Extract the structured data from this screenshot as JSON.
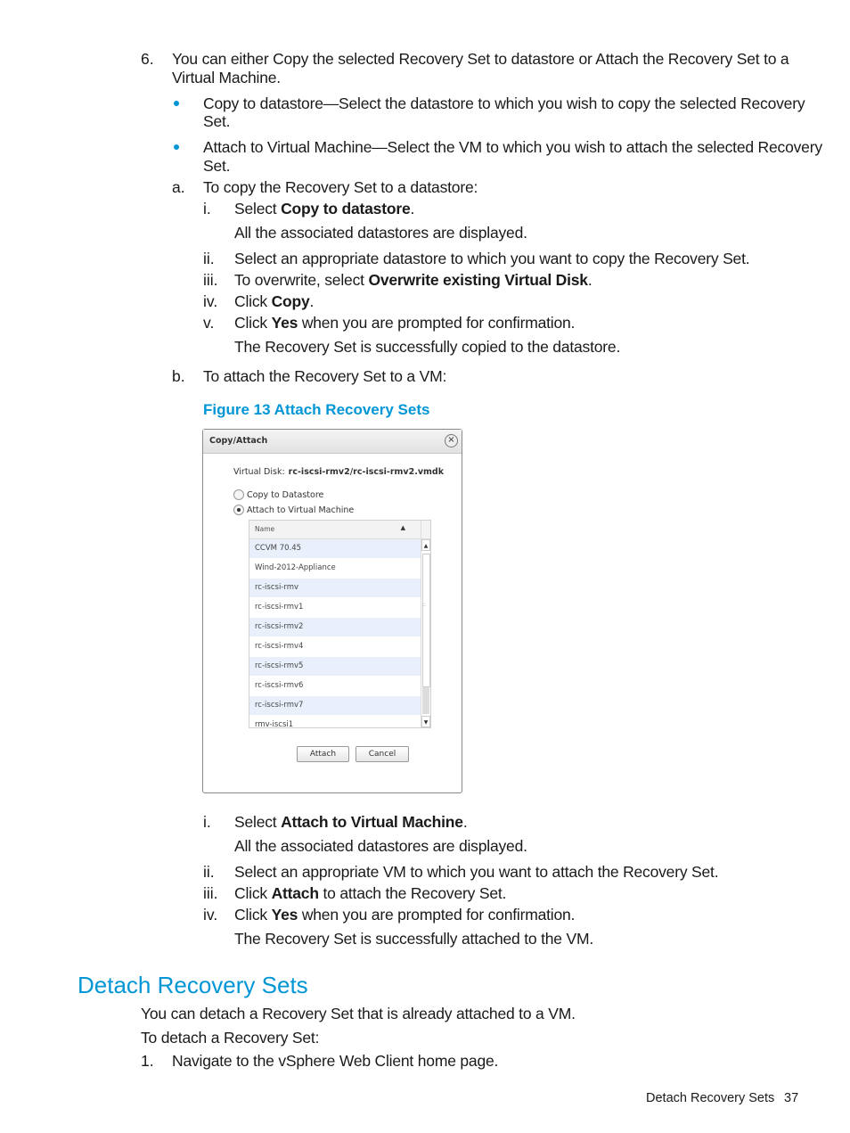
{
  "step6": {
    "number": "6.",
    "line1": "You can either Copy the selected Recovery Set to datastore or Attach the Recovery Set to a",
    "line2": "Virtual Machine.",
    "bullets": [
      {
        "line1": "Copy to datastore—Select the datastore to which you wish to copy the selected Recovery",
        "line2": "Set."
      },
      {
        "line1": "Attach to Virtual Machine—Select the VM to which you wish to attach the selected Recovery",
        "line2": "Set."
      }
    ]
  },
  "sub_a": {
    "label": "a.",
    "text": "To copy the Recovery Set to a datastore:",
    "steps": [
      {
        "num": "i.",
        "pre": "Select ",
        "bold": "Copy to datastore",
        "post": ".",
        "note": "All the associated datastores are displayed."
      },
      {
        "num": "ii.",
        "pre": "Select an appropriate datastore to which you want to copy the Recovery Set.",
        "bold": "",
        "post": ""
      },
      {
        "num": "iii.",
        "pre": "To overwrite, select ",
        "bold": "Overwrite existing Virtual Disk",
        "post": "."
      },
      {
        "num": "iv.",
        "pre": "Click ",
        "bold": "Copy",
        "post": "."
      },
      {
        "num": "v.",
        "pre": "Click ",
        "bold": "Yes",
        "post": " when you are prompted for confirmation.",
        "note": "The Recovery Set is successfully copied to the datastore."
      }
    ]
  },
  "sub_b": {
    "label": "b.",
    "text": "To attach the Recovery Set to a VM:",
    "steps": [
      {
        "num": "i.",
        "pre": "Select ",
        "bold": "Attach to Virtual Machine",
        "post": ".",
        "note": "All the associated datastores are displayed."
      },
      {
        "num": "ii.",
        "pre": "Select an appropriate VM to which you want to attach the Recovery Set.",
        "bold": "",
        "post": ""
      },
      {
        "num": "iii.",
        "pre": "Click ",
        "bold": "Attach",
        "post": " to attach the Recovery Set."
      },
      {
        "num": "iv.",
        "pre": "Click ",
        "bold": "Yes",
        "post": " when you are prompted for confirmation.",
        "note": "The Recovery Set is successfully attached to the VM."
      }
    ]
  },
  "figure": {
    "caption": "Figure 13 Attach Recovery Sets",
    "dialog": {
      "title": "Copy/Attach",
      "close_icon": "×",
      "virtual_disk_label": "Virtual Disk:",
      "virtual_disk_value": "rc-iscsi-rmv2/rc-iscsi-rmv2.vmdk",
      "options": [
        {
          "label": "Copy to Datastore",
          "selected": false
        },
        {
          "label": "Attach to Virtual Machine",
          "selected": true
        }
      ],
      "grid": {
        "column": "Name",
        "sort_icon": "▲",
        "rows": [
          "CCVM 70.45",
          "Wind-2012-Appliance",
          "rc-iscsi-rmv",
          "rc-iscsi-rmv1",
          "rc-iscsi-rmv2",
          "rc-iscsi-rmv4",
          "rc-iscsi-rmv5",
          "rc-iscsi-rmv6",
          "rc-iscsi-rmv7",
          "rmv-iscsi1"
        ]
      },
      "scroll_up": "▲",
      "scroll_down": "▼",
      "grip": "::",
      "attach_button": "Attach",
      "cancel_button": "Cancel"
    }
  },
  "section": {
    "heading": "Detach Recovery Sets",
    "intro": "You can detach a Recovery Set that is already attached to a VM.",
    "lead": "To detach a Recovery Set:",
    "steps": [
      {
        "num": "1.",
        "text": "Navigate to the vSphere Web Client home page."
      }
    ]
  },
  "footer": {
    "section": "Detach Recovery Sets",
    "page": "37"
  },
  "colors": {
    "accent": "#0096d6"
  }
}
